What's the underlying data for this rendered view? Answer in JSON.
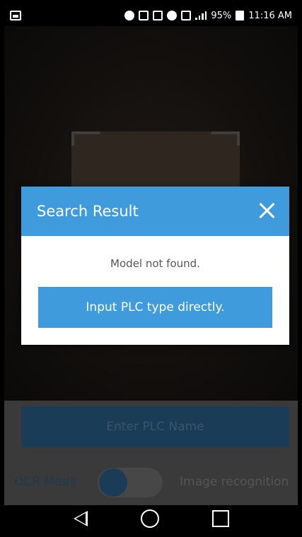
{
  "status_bar": {
    "battery": "95%",
    "time": "11:16 AM",
    "icons": [
      "gallery-icon",
      "bluetooth-icon",
      "nfc-icon",
      "vibrate-icon",
      "wifi-icon",
      "data-icon",
      "signal-icon",
      "battery-icon"
    ]
  },
  "dialog": {
    "title": "Search Result",
    "message": "Model not found.",
    "button_label": "Input PLC type directly.",
    "close_icon": "close-icon"
  },
  "controls": {
    "enter_name_label": "Enter PLC Name",
    "ocr_label": "OCR Mode",
    "image_label": "Image recognition"
  },
  "nav": {
    "icons": [
      "back-icon",
      "home-icon",
      "recent-apps-icon"
    ]
  },
  "colors": {
    "accent": "#3f9bdb",
    "dialog_bg": "#ffffff",
    "status_bar": "#000000"
  }
}
